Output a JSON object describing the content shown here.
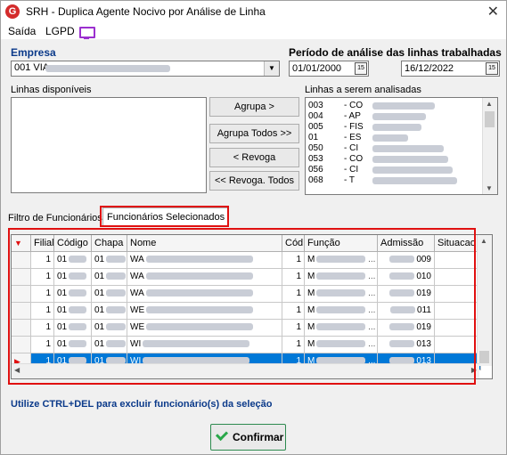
{
  "window": {
    "title": "SRH - Duplica Agente Nocivo por Análise de Linha",
    "close_symbol": "✕",
    "logo_letter": "G"
  },
  "menu": {
    "items": [
      "Saída",
      "LGPD"
    ]
  },
  "empresa": {
    "label": "Empresa",
    "value": "001 VIA"
  },
  "periodo": {
    "label": "Período de análise das linhas trabalhadas",
    "start": "01/01/2000",
    "end": "16/12/2022",
    "cal_icon": "15"
  },
  "linhas_disponiveis": {
    "label": "Linhas disponíveis"
  },
  "buttons": {
    "agrupa": "Agrupa >",
    "agrupa_todos": "Agrupa Todos >>",
    "revoga": "< Revoga",
    "revoga_todos": "<< Revoga. Todos",
    "confirmar": "Confirmar"
  },
  "linhas_analisadas": {
    "label": "Linhas a serem analisadas",
    "items": [
      {
        "code": "003",
        "desc": "- CO"
      },
      {
        "code": "004",
        "desc": "- AP"
      },
      {
        "code": "005",
        "desc": "- FIS"
      },
      {
        "code": "01",
        "desc": "- ES"
      },
      {
        "code": "050",
        "desc": "- CI"
      },
      {
        "code": "053",
        "desc": "- CO"
      },
      {
        "code": "056",
        "desc": "- CI"
      },
      {
        "code": "068",
        "desc": "- T"
      }
    ]
  },
  "tabs": {
    "filtro": "Filtro de Funcionários",
    "selecionados": "Funcionários Selecionados"
  },
  "grid": {
    "headers": [
      "Filial",
      "Código",
      "Chapa",
      "Nome",
      "Cód",
      "Função",
      "Admissão",
      "Situacao"
    ],
    "rows": [
      {
        "filial": "1",
        "codigo": "01",
        "chapa": "01",
        "nome": "WA",
        "cod": "1",
        "funcao": "M",
        "admissao": "009"
      },
      {
        "filial": "1",
        "codigo": "01",
        "chapa": "01",
        "nome": "WA",
        "cod": "1",
        "funcao": "M",
        "admissao": "010"
      },
      {
        "filial": "1",
        "codigo": "01",
        "chapa": "01",
        "nome": "WA",
        "cod": "1",
        "funcao": "M",
        "admissao": "019"
      },
      {
        "filial": "1",
        "codigo": "01",
        "chapa": "01",
        "nome": "WE",
        "cod": "1",
        "funcao": "M",
        "admissao": "011"
      },
      {
        "filial": "1",
        "codigo": "01",
        "chapa": "01",
        "nome": "WE",
        "cod": "1",
        "funcao": "M",
        "admissao": "019"
      },
      {
        "filial": "1",
        "codigo": "01",
        "chapa": "01",
        "nome": "WI",
        "cod": "1",
        "funcao": "M",
        "admissao": "013"
      },
      {
        "filial": "1",
        "codigo": "01",
        "chapa": "01",
        "nome": "WI",
        "cod": "1",
        "funcao": "M",
        "admissao": "013"
      }
    ]
  },
  "status": {
    "hint": "Utilize CTRL+DEL para excluir funcionário(s) da seleção"
  },
  "colors": {
    "accent_red": "#e01010",
    "label_blue": "#0b3a8a",
    "selection_blue": "#0078d7",
    "confirm_green": "#2aa84a",
    "lgpd_purple": "#9b2fcf"
  }
}
